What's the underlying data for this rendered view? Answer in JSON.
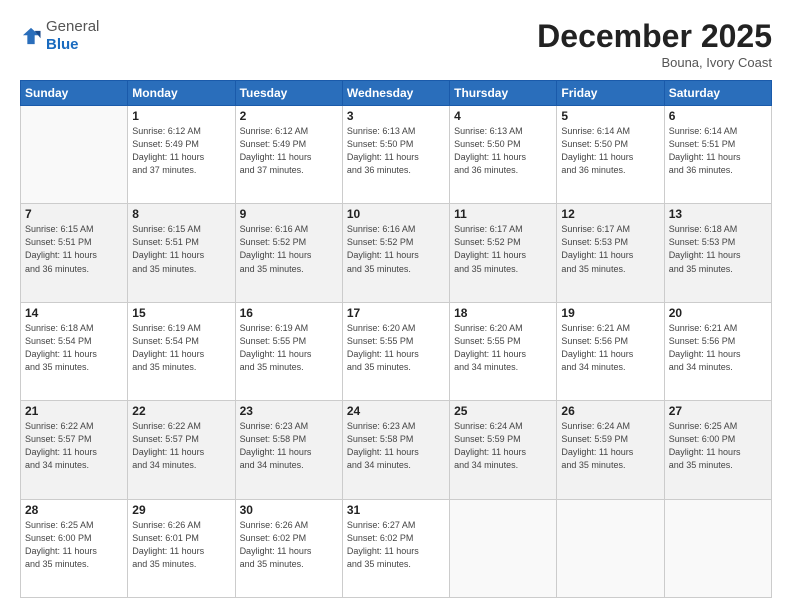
{
  "header": {
    "logo_general": "General",
    "logo_blue": "Blue",
    "month_title": "December 2025",
    "subtitle": "Bouna, Ivory Coast"
  },
  "weekdays": [
    "Sunday",
    "Monday",
    "Tuesday",
    "Wednesday",
    "Thursday",
    "Friday",
    "Saturday"
  ],
  "weeks": [
    [
      {
        "day": null
      },
      {
        "day": "1",
        "sunrise": "6:12 AM",
        "sunset": "5:49 PM",
        "daylight": "11 hours and 37 minutes."
      },
      {
        "day": "2",
        "sunrise": "6:12 AM",
        "sunset": "5:49 PM",
        "daylight": "11 hours and 37 minutes."
      },
      {
        "day": "3",
        "sunrise": "6:13 AM",
        "sunset": "5:50 PM",
        "daylight": "11 hours and 36 minutes."
      },
      {
        "day": "4",
        "sunrise": "6:13 AM",
        "sunset": "5:50 PM",
        "daylight": "11 hours and 36 minutes."
      },
      {
        "day": "5",
        "sunrise": "6:14 AM",
        "sunset": "5:50 PM",
        "daylight": "11 hours and 36 minutes."
      },
      {
        "day": "6",
        "sunrise": "6:14 AM",
        "sunset": "5:51 PM",
        "daylight": "11 hours and 36 minutes."
      }
    ],
    [
      {
        "day": "7",
        "sunrise": "6:15 AM",
        "sunset": "5:51 PM",
        "daylight": "11 hours and 36 minutes."
      },
      {
        "day": "8",
        "sunrise": "6:15 AM",
        "sunset": "5:51 PM",
        "daylight": "11 hours and 35 minutes."
      },
      {
        "day": "9",
        "sunrise": "6:16 AM",
        "sunset": "5:52 PM",
        "daylight": "11 hours and 35 minutes."
      },
      {
        "day": "10",
        "sunrise": "6:16 AM",
        "sunset": "5:52 PM",
        "daylight": "11 hours and 35 minutes."
      },
      {
        "day": "11",
        "sunrise": "6:17 AM",
        "sunset": "5:52 PM",
        "daylight": "11 hours and 35 minutes."
      },
      {
        "day": "12",
        "sunrise": "6:17 AM",
        "sunset": "5:53 PM",
        "daylight": "11 hours and 35 minutes."
      },
      {
        "day": "13",
        "sunrise": "6:18 AM",
        "sunset": "5:53 PM",
        "daylight": "11 hours and 35 minutes."
      }
    ],
    [
      {
        "day": "14",
        "sunrise": "6:18 AM",
        "sunset": "5:54 PM",
        "daylight": "11 hours and 35 minutes."
      },
      {
        "day": "15",
        "sunrise": "6:19 AM",
        "sunset": "5:54 PM",
        "daylight": "11 hours and 35 minutes."
      },
      {
        "day": "16",
        "sunrise": "6:19 AM",
        "sunset": "5:55 PM",
        "daylight": "11 hours and 35 minutes."
      },
      {
        "day": "17",
        "sunrise": "6:20 AM",
        "sunset": "5:55 PM",
        "daylight": "11 hours and 35 minutes."
      },
      {
        "day": "18",
        "sunrise": "6:20 AM",
        "sunset": "5:55 PM",
        "daylight": "11 hours and 34 minutes."
      },
      {
        "day": "19",
        "sunrise": "6:21 AM",
        "sunset": "5:56 PM",
        "daylight": "11 hours and 34 minutes."
      },
      {
        "day": "20",
        "sunrise": "6:21 AM",
        "sunset": "5:56 PM",
        "daylight": "11 hours and 34 minutes."
      }
    ],
    [
      {
        "day": "21",
        "sunrise": "6:22 AM",
        "sunset": "5:57 PM",
        "daylight": "11 hours and 34 minutes."
      },
      {
        "day": "22",
        "sunrise": "6:22 AM",
        "sunset": "5:57 PM",
        "daylight": "11 hours and 34 minutes."
      },
      {
        "day": "23",
        "sunrise": "6:23 AM",
        "sunset": "5:58 PM",
        "daylight": "11 hours and 34 minutes."
      },
      {
        "day": "24",
        "sunrise": "6:23 AM",
        "sunset": "5:58 PM",
        "daylight": "11 hours and 34 minutes."
      },
      {
        "day": "25",
        "sunrise": "6:24 AM",
        "sunset": "5:59 PM",
        "daylight": "11 hours and 34 minutes."
      },
      {
        "day": "26",
        "sunrise": "6:24 AM",
        "sunset": "5:59 PM",
        "daylight": "11 hours and 35 minutes."
      },
      {
        "day": "27",
        "sunrise": "6:25 AM",
        "sunset": "6:00 PM",
        "daylight": "11 hours and 35 minutes."
      }
    ],
    [
      {
        "day": "28",
        "sunrise": "6:25 AM",
        "sunset": "6:00 PM",
        "daylight": "11 hours and 35 minutes."
      },
      {
        "day": "29",
        "sunrise": "6:26 AM",
        "sunset": "6:01 PM",
        "daylight": "11 hours and 35 minutes."
      },
      {
        "day": "30",
        "sunrise": "6:26 AM",
        "sunset": "6:02 PM",
        "daylight": "11 hours and 35 minutes."
      },
      {
        "day": "31",
        "sunrise": "6:27 AM",
        "sunset": "6:02 PM",
        "daylight": "11 hours and 35 minutes."
      },
      {
        "day": null
      },
      {
        "day": null
      },
      {
        "day": null
      }
    ]
  ],
  "labels": {
    "sunrise": "Sunrise:",
    "sunset": "Sunset:",
    "daylight": "Daylight:"
  }
}
